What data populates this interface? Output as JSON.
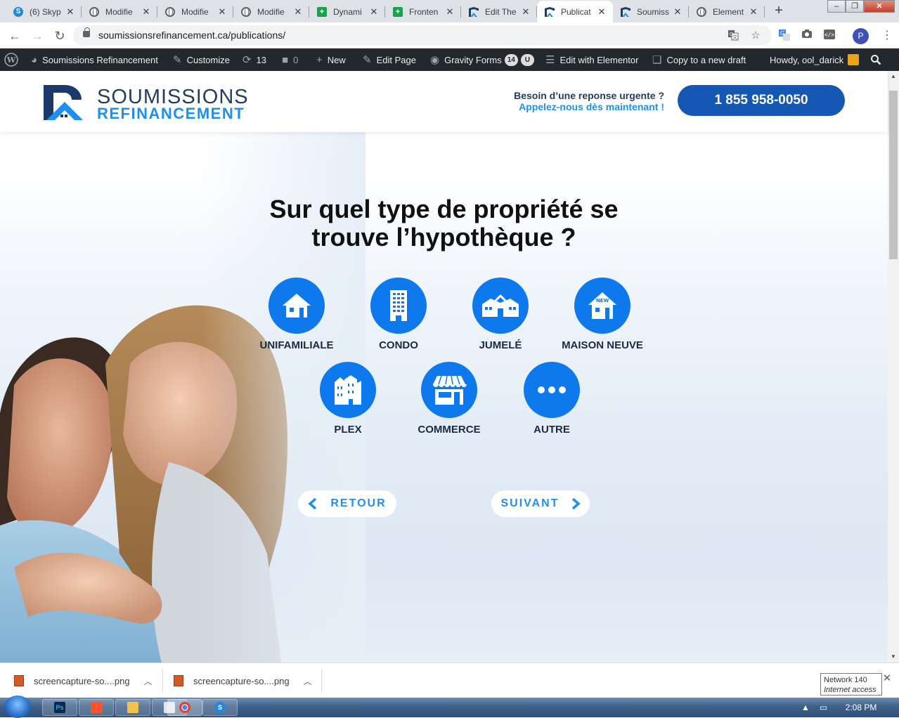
{
  "browser": {
    "tabs": [
      {
        "title": "(6) Skyp",
        "favicon": "skype-icon"
      },
      {
        "title": "Modifie",
        "favicon": "globe-icon"
      },
      {
        "title": "Modifie",
        "favicon": "globe-icon"
      },
      {
        "title": "Modifie",
        "favicon": "globe-icon"
      },
      {
        "title": "Dynami",
        "favicon": "sheets-icon"
      },
      {
        "title": "Fronten",
        "favicon": "sheets-icon"
      },
      {
        "title": "Edit The",
        "favicon": "site-logo-icon"
      },
      {
        "title": "Publicat",
        "favicon": "site-logo-icon",
        "active": true
      },
      {
        "title": "Soumiss",
        "favicon": "site-logo-icon"
      },
      {
        "title": "Element",
        "favicon": "globe-icon"
      }
    ],
    "new_tab": "+",
    "url": "soumissionsrefinancement.ca/publications/",
    "profile_initial": "P"
  },
  "admin_bar": {
    "site_name": "Soumissions Refinancement",
    "customize": "Customize",
    "updates_count": "13",
    "comments_count": "0",
    "new": "New",
    "edit_page": "Edit Page",
    "gravity_forms": "Gravity Forms",
    "gravity_badge": "14",
    "gravity_badge2": "U",
    "elementor": "Edit with Elementor",
    "copy_draft": "Copy to a new draft",
    "howdy": "Howdy, ool_darick"
  },
  "header": {
    "logo_word1": "SOUMISSIONS",
    "logo_word2": "REFINANCEMENT",
    "urgent_question": "Besoin d’une reponse urgente ?",
    "urgent_call": "Appelez-nous dès maintenant !",
    "phone": "1 855 958-0050"
  },
  "hero": {
    "title_line1": "Sur quel type de propriété se",
    "title_line2": "trouve l’hypothèque ?",
    "options": [
      {
        "label": "UNIFAMILIALE",
        "icon": "house-icon"
      },
      {
        "label": "CONDO",
        "icon": "building-icon"
      },
      {
        "label": "JUMELÉ",
        "icon": "semi-detached-icon"
      },
      {
        "label": "MAISON NEUVE",
        "icon": "new-house-icon",
        "icon_text": "NEW"
      },
      {
        "label": "PLEX",
        "icon": "plex-icon"
      },
      {
        "label": "COMMERCE",
        "icon": "storefront-icon"
      },
      {
        "label": "AUTRE",
        "icon": "more-dots-icon"
      }
    ],
    "back_label": "RETOUR",
    "next_label": "SUIVANT"
  },
  "downloads": {
    "items": [
      {
        "name": "screencapture-so....png"
      },
      {
        "name": "screencapture-so....png"
      }
    ],
    "network_tip_line1": "Network  140",
    "network_tip_line2": "Internet access"
  },
  "taskbar": {
    "apps": [
      "Ps",
      "Brave",
      "Explorer",
      "Notes",
      "Chrome",
      "Skype"
    ],
    "clock": "2:08 PM"
  },
  "colors": {
    "brand_dark": "#263c5e",
    "brand_blue": "#1d8ff0",
    "circle_blue": "#0d79ec",
    "phone_button": "#1558b4",
    "admin_bar": "#23282d"
  }
}
